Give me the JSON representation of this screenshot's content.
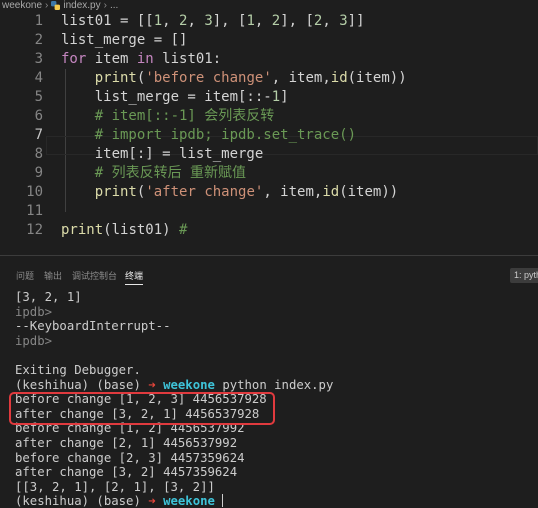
{
  "breadcrumb": {
    "folder": "weekone",
    "file": "index.py",
    "tail": "..."
  },
  "editor": {
    "lines": [
      {
        "n": "1",
        "tokens": [
          [
            "op",
            "list01 = [["
          ],
          [
            "num",
            "1"
          ],
          [
            "op",
            ", "
          ],
          [
            "num",
            "2"
          ],
          [
            "op",
            ", "
          ],
          [
            "num",
            "3"
          ],
          [
            "op",
            "], ["
          ],
          [
            "num",
            "1"
          ],
          [
            "op",
            ", "
          ],
          [
            "num",
            "2"
          ],
          [
            "op",
            "], ["
          ],
          [
            "num",
            "2"
          ],
          [
            "op",
            ", "
          ],
          [
            "num",
            "3"
          ],
          [
            "op",
            "]]"
          ]
        ]
      },
      {
        "n": "2",
        "tokens": [
          [
            "op",
            "list_merge = []"
          ]
        ]
      },
      {
        "n": "3",
        "tokens": [
          [
            "kw2",
            "for"
          ],
          [
            "op",
            " item "
          ],
          [
            "kw2",
            "in"
          ],
          [
            "op",
            " list01:"
          ]
        ]
      },
      {
        "n": "4",
        "tokens": [
          [
            "op",
            "    "
          ],
          [
            "fn",
            "print"
          ],
          [
            "op",
            "("
          ],
          [
            "str",
            "'before change'"
          ],
          [
            "op",
            ", item,"
          ],
          [
            "fn",
            "id"
          ],
          [
            "op",
            "(item))"
          ]
        ]
      },
      {
        "n": "5",
        "tokens": [
          [
            "op",
            "    list_merge = item[::-"
          ],
          [
            "num",
            "1"
          ],
          [
            "op",
            "]"
          ]
        ]
      },
      {
        "n": "6",
        "tokens": [
          [
            "cm",
            "    # item[::-1] 会列表反转"
          ]
        ]
      },
      {
        "n": "7",
        "tokens": [
          [
            "cm",
            "    # import ipdb; ipdb.set_trace()"
          ]
        ]
      },
      {
        "n": "8",
        "tokens": [
          [
            "op",
            "    item[:] = list_merge"
          ]
        ]
      },
      {
        "n": "9",
        "tokens": [
          [
            "cm",
            "    # 列表反转后 重新赋值"
          ]
        ]
      },
      {
        "n": "10",
        "tokens": [
          [
            "op",
            "    "
          ],
          [
            "fn",
            "print"
          ],
          [
            "op",
            "("
          ],
          [
            "str",
            "'after change'"
          ],
          [
            "op",
            ", item,"
          ],
          [
            "fn",
            "id"
          ],
          [
            "op",
            "(item))"
          ]
        ]
      },
      {
        "n": "11",
        "tokens": []
      },
      {
        "n": "12",
        "tokens": [
          [
            "fn",
            "print"
          ],
          [
            "op",
            "(list01) "
          ],
          [
            "cm",
            "#"
          ]
        ]
      }
    ],
    "active_line": "7"
  },
  "panel": {
    "tabs": [
      "问题",
      "输出",
      "调试控制台",
      "终端"
    ],
    "active_tab": "终端",
    "terminal_select": "1: pyth"
  },
  "terminal": {
    "lines": [
      {
        "text": "[3, 2, 1]"
      },
      {
        "text": "ipdb>",
        "dim": true
      },
      {
        "text": "--KeyboardInterrupt--"
      },
      {
        "text": "ipdb>",
        "dim": true
      },
      {
        "text": ""
      },
      {
        "text": "Exiting Debugger."
      },
      {
        "prompt": true,
        "env": "(keshihua) (base)",
        "arrow": "➜",
        "dir": "weekone",
        "cmd": "python index.py"
      },
      {
        "text": "before change [1, 2, 3] 4456537928"
      },
      {
        "text": "after change [3, 2, 1] 4456537928"
      },
      {
        "text": "before change [1, 2] 4456537992"
      },
      {
        "text": "after change [2, 1] 4456537992"
      },
      {
        "text": "before change [2, 3] 4457359624"
      },
      {
        "text": "after change [3, 2] 4457359624"
      },
      {
        "text": "[[3, 2, 1], [2, 1], [3, 2]]"
      },
      {
        "prompt": true,
        "env": "(keshihua) (base)",
        "arrow": "➜",
        "dir": "weekone",
        "cmd": "",
        "cursor": true
      }
    ]
  },
  "colors": {
    "highlight_box": "#e03a3e",
    "prompt_arrow": "#e4453a",
    "prompt_dir": "#3ec3d8"
  }
}
